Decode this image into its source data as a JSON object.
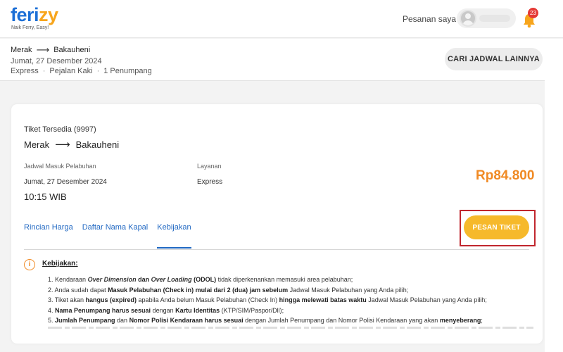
{
  "brand": {
    "name_part1": "feri",
    "name_part2": "zy",
    "tagline": "Naik Ferry, Easy!"
  },
  "header": {
    "orders_label": "Pesanan saya",
    "notification_count": "23"
  },
  "search": {
    "origin": "Merak",
    "destination": "Bakauheni",
    "arrow": "⟶",
    "date": "Jumat, 27 Desember 2024",
    "service": "Express",
    "passenger_type": "Pejalan Kaki",
    "passenger_count": "1 Penumpang",
    "separator": "·",
    "other_schedule_label": "CARI JADWAL LAINNYA"
  },
  "ticket": {
    "available_label": "Tiket Tersedia (9997)",
    "origin": "Merak",
    "destination": "Bakauheni",
    "arrow": "⟶",
    "schedule_label": "Jadwal Masuk Pelabuhan",
    "service_label": "Layanan",
    "date": "Jumat, 27 Desember 2024",
    "service": "Express",
    "time": "10:15 WIB",
    "price": "Rp84.800",
    "order_label": "PESAN TIKET",
    "tabs": [
      {
        "label": "Rincian Harga"
      },
      {
        "label": "Daftar Nama Kapal"
      },
      {
        "label": "Kebijakan"
      }
    ],
    "active_tab": "Kebijakan"
  },
  "policy": {
    "icon_symbol": "i",
    "title": "Kebijakan:",
    "items": [
      {
        "n": "1. ",
        "a": "Kendaraan ",
        "b1": "Over Dimension",
        "c": " dan ",
        "b2": "Over Loading",
        "d": " (ODOL)",
        "e": " tidak diperkenankan memasuki area pelabuhan;"
      },
      {
        "n": "2. ",
        "a": "Anda sudah dapat ",
        "b": "Masuk Pelabuhan (Check in) mulai dari 2 (dua) jam sebelum",
        "c": " Jadwal Masuk Pelabuhan yang Anda pilih;"
      },
      {
        "n": "3. ",
        "a": "Tiket akan ",
        "b": "hangus (expired)",
        "c": " apabila Anda belum Masuk Pelabuhan (Check In) ",
        "d": "hingga melewati batas waktu",
        "e": " Jadwal Masuk Pelabuhan yang Anda pilih;"
      },
      {
        "n": "4. ",
        "b": "Nama Penumpang harus sesuai",
        "c": " dengan ",
        "d": "Kartu Identitas",
        "e": " (KTP/SIM/Paspor/Dll);"
      },
      {
        "n": "5. ",
        "b": "Jumlah Penumpang",
        "c": " dan ",
        "d": "Nomor Polisi Kendaraan harus sesuai",
        "e": " dengan Jumlah Penumpang dan Nomor Polisi Kendaraan yang akan ",
        "f": "menyeberang",
        "g": ";"
      }
    ]
  },
  "colors": {
    "brand_blue": "#1c6fd6",
    "brand_orange": "#f7a51c",
    "price": "#f08a24",
    "order_button": "#f6b92b",
    "highlight_box": "#c0262d",
    "notification_badge": "#e53935"
  }
}
